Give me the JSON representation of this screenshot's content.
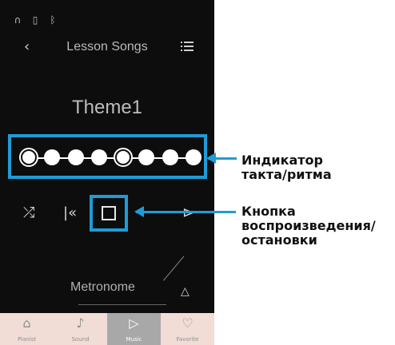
{
  "status": {
    "icons": [
      "headphones-icon",
      "usb-icon",
      "bluetooth-icon"
    ]
  },
  "header": {
    "back": "‹",
    "title": "Lesson Songs",
    "list_icon": "list-icon"
  },
  "song": {
    "title": "Theme1"
  },
  "beats": {
    "count": 8,
    "accented_positions": [
      1,
      5
    ],
    "active": 1
  },
  "controls": {
    "shuffle": "⤮",
    "prev": "|«",
    "stop_icon": "stop-icon",
    "next": "⊳"
  },
  "metronome": {
    "label": "Metronome",
    "icon": "△"
  },
  "tabs": [
    {
      "label": "Pianist",
      "icon": "⌂",
      "active": false
    },
    {
      "label": "Sound",
      "icon": "♪",
      "active": false
    },
    {
      "label": "Music",
      "icon": "▷",
      "active": true
    },
    {
      "label": "Favorite",
      "icon": "♡",
      "active": false
    }
  ],
  "callouts": {
    "beat_indicator": [
      "Индикатор",
      "такта/ритма"
    ],
    "playstop": [
      "Кнопка",
      "воспроизведения/",
      "остановки"
    ]
  },
  "colors": {
    "accent": "#1e9cd7",
    "background": "#0d0d0d",
    "tabbar": "#f1dcd6"
  }
}
